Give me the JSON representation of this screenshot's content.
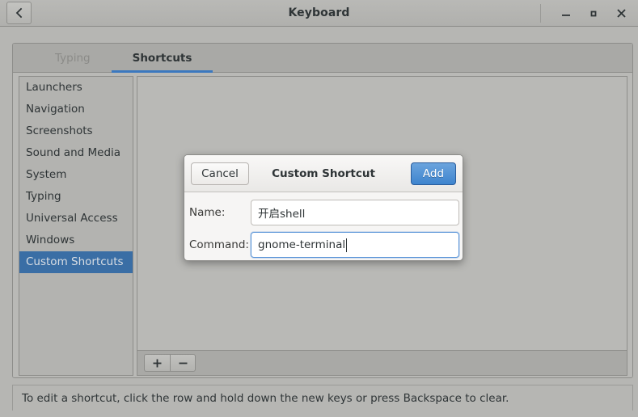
{
  "window": {
    "title": "Keyboard",
    "back_icon": "chevron-left-icon",
    "controls": {
      "minimize_icon": "minimize-icon",
      "maximize_icon": "maximize-icon",
      "close_icon": "close-icon"
    }
  },
  "tabs": [
    {
      "label": "Typing",
      "active": false
    },
    {
      "label": "Shortcuts",
      "active": true
    }
  ],
  "sidebar": {
    "items": [
      {
        "label": "Launchers",
        "selected": false
      },
      {
        "label": "Navigation",
        "selected": false
      },
      {
        "label": "Screenshots",
        "selected": false
      },
      {
        "label": "Sound and Media",
        "selected": false
      },
      {
        "label": "System",
        "selected": false
      },
      {
        "label": "Typing",
        "selected": false
      },
      {
        "label": "Universal Access",
        "selected": false
      },
      {
        "label": "Windows",
        "selected": false
      },
      {
        "label": "Custom Shortcuts",
        "selected": true
      }
    ]
  },
  "toolbar": {
    "add_label": "+",
    "remove_label": "−",
    "add_icon": "plus-icon",
    "remove_icon": "minus-icon"
  },
  "statusbar": {
    "text": "To edit a shortcut, click the row and hold down the new keys or press Backspace to clear."
  },
  "dialog": {
    "title": "Custom Shortcut",
    "cancel_label": "Cancel",
    "add_label": "Add",
    "fields": [
      {
        "label": "Name:",
        "value": "开启shell",
        "placeholder": "",
        "focused": false
      },
      {
        "label": "Command:",
        "value": "gnome-terminal",
        "placeholder": "",
        "focused": true
      }
    ]
  },
  "colors": {
    "accent_blue": "#3b78bf",
    "selection_blue": "#3a6ea5",
    "button_blue": "#3e84ce",
    "window_bg": "#b6b6b3",
    "text": "#2e3436"
  }
}
